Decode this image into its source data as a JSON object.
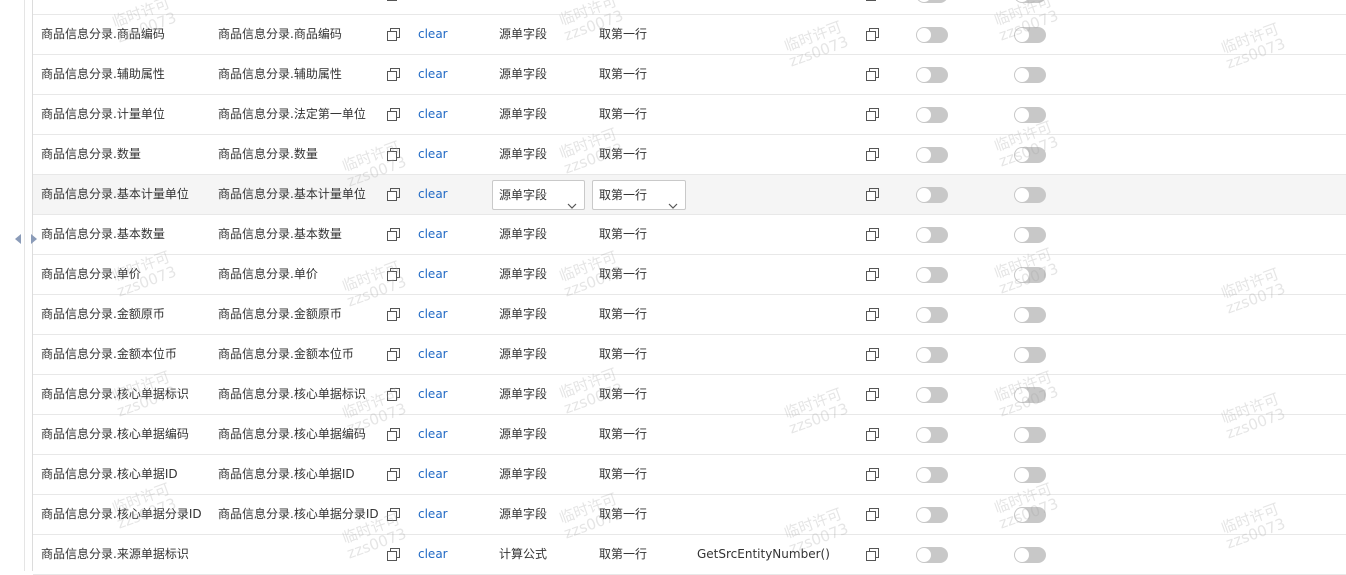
{
  "rows": [
    {
      "source": "商品信息分录.商品编码",
      "target": "商品信息分录.商品编码",
      "clear": "clear",
      "type": "源单字段",
      "take": "取第一行",
      "formula": ""
    },
    {
      "source": "商品信息分录.辅助属性",
      "target": "商品信息分录.辅助属性",
      "clear": "clear",
      "type": "源单字段",
      "take": "取第一行",
      "formula": ""
    },
    {
      "source": "商品信息分录.计量单位",
      "target": "商品信息分录.法定第一单位",
      "clear": "clear",
      "type": "源单字段",
      "take": "取第一行",
      "formula": ""
    },
    {
      "source": "商品信息分录.数量",
      "target": "商品信息分录.数量",
      "clear": "clear",
      "type": "源单字段",
      "take": "取第一行",
      "formula": ""
    },
    {
      "source": "商品信息分录.基本计量单位",
      "target": "商品信息分录.基本计量单位",
      "clear": "clear",
      "type": "源单字段",
      "take": "取第一行",
      "formula": ""
    },
    {
      "source": "商品信息分录.基本数量",
      "target": "商品信息分录.基本数量",
      "clear": "clear",
      "type": "源单字段",
      "take": "取第一行",
      "formula": ""
    },
    {
      "source": "商品信息分录.单价",
      "target": "商品信息分录.单价",
      "clear": "clear",
      "type": "源单字段",
      "take": "取第一行",
      "formula": ""
    },
    {
      "source": "商品信息分录.金额原币",
      "target": "商品信息分录.金额原币",
      "clear": "clear",
      "type": "源单字段",
      "take": "取第一行",
      "formula": ""
    },
    {
      "source": "商品信息分录.金额本位币",
      "target": "商品信息分录.金额本位币",
      "clear": "clear",
      "type": "源单字段",
      "take": "取第一行",
      "formula": ""
    },
    {
      "source": "商品信息分录.核心单据标识",
      "target": "商品信息分录.核心单据标识",
      "clear": "clear",
      "type": "源单字段",
      "take": "取第一行",
      "formula": ""
    },
    {
      "source": "商品信息分录.核心单据编码",
      "target": "商品信息分录.核心单据编码",
      "clear": "clear",
      "type": "源单字段",
      "take": "取第一行",
      "formula": ""
    },
    {
      "source": "商品信息分录.核心单据ID",
      "target": "商品信息分录.核心单据ID",
      "clear": "clear",
      "type": "源单字段",
      "take": "取第一行",
      "formula": ""
    },
    {
      "source": "商品信息分录.核心单据分录ID",
      "target": "商品信息分录.核心单据分录ID",
      "clear": "clear",
      "type": "源单字段",
      "take": "取第一行",
      "formula": ""
    },
    {
      "source": "商品信息分录.来源单据标识",
      "target": "",
      "clear": "clear",
      "type": "计算公式",
      "take": "取第一行",
      "formula": "GetSrcEntityNumber()"
    }
  ],
  "watermark": {
    "line1": "临时许可",
    "line2": "zzs0073"
  },
  "colors": {
    "link": "#1f68c4",
    "toggle_off": "#c8c8c8",
    "row_highlight": "#f5f5f5",
    "border": "#e8e8e8"
  },
  "icons": {
    "copy": "copy-icon",
    "collapse": "collapse-arrows-icon",
    "dropdown": "chevron-down-icon"
  }
}
